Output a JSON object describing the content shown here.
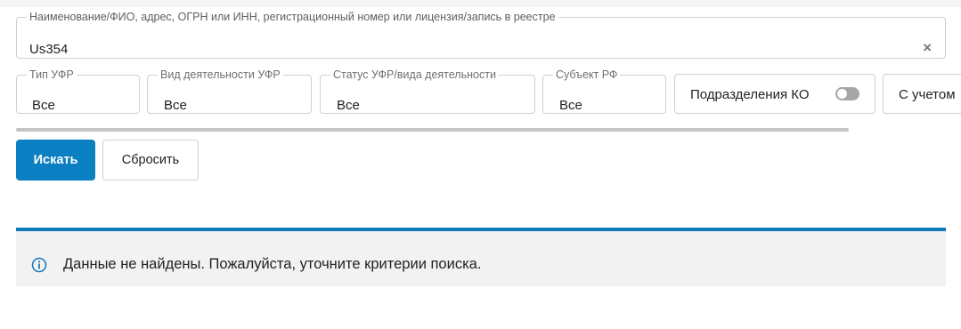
{
  "search": {
    "legend": "Наименование/ФИО, адрес, ОГРН или ИНН, регистрационный номер или лицензия/запись в реестре",
    "value": "Us354",
    "clear": "×"
  },
  "filters": [
    {
      "label": "Тип УФР",
      "value": "Все"
    },
    {
      "label": "Вид деятельности УФР",
      "value": "Все"
    },
    {
      "label": "Статус УФР/вида деятельности",
      "value": "Все"
    },
    {
      "label": "Субъект РФ",
      "value": "Все"
    }
  ],
  "toggle_ko": {
    "label": "Подразделения КО",
    "state": "off"
  },
  "extra_filter": {
    "label": "С учетом"
  },
  "buttons": {
    "search": "Искать",
    "reset": "Сбросить"
  },
  "alert": {
    "text": "Данные не найдены. Пожалуйста, уточните критерии поиска.",
    "icon": "info-icon",
    "accent_color": "#1279bd"
  },
  "colors": {
    "primary": "#0a7fc1"
  }
}
